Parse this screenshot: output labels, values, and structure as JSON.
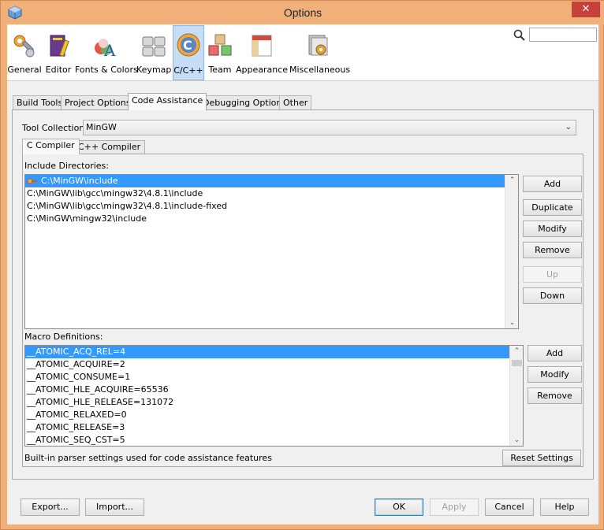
{
  "window": {
    "title": "Options",
    "close_glyph": "✕"
  },
  "categories": [
    {
      "label": "General",
      "icon": "wrench-gears-icon"
    },
    {
      "label": "Editor",
      "icon": "notebook-pencil-icon"
    },
    {
      "label": "Fonts & Colors",
      "icon": "font-colors-icon"
    },
    {
      "label": "Keymap",
      "icon": "keyboard-icon"
    },
    {
      "label": "C/C++",
      "icon": "cpp-icon",
      "selected": true
    },
    {
      "label": "Team",
      "icon": "team-cubes-icon"
    },
    {
      "label": "Appearance",
      "icon": "appearance-icon"
    },
    {
      "label": "Miscellaneous",
      "icon": "misc-icon"
    }
  ],
  "search": {
    "value": "",
    "placeholder": ""
  },
  "tabs": [
    "Build Tools",
    "Project Options",
    "Code Assistance",
    "Debugging Options",
    "Other"
  ],
  "active_tab": "Code Assistance",
  "tool_collection": {
    "label": "Tool Collection:",
    "value": "MinGW"
  },
  "subtabs": [
    "C Compiler",
    "C++ Compiler"
  ],
  "include": {
    "label": "Include Directories:",
    "items": [
      "C:\\MinGW\\include",
      "C:\\MinGW\\lib\\gcc\\mingw32\\4.8.1\\include",
      "C:\\MinGW\\lib\\gcc\\mingw32\\4.8.1\\include-fixed",
      "C:\\MinGW\\mingw32\\include"
    ],
    "buttons": {
      "add": "Add",
      "duplicate": "Duplicate",
      "modify": "Modify",
      "remove": "Remove",
      "up": "Up",
      "down": "Down"
    }
  },
  "macros": {
    "label": "Macro Definitions:",
    "items": [
      "__ATOMIC_ACQ_REL=4",
      "__ATOMIC_ACQUIRE=2",
      "__ATOMIC_CONSUME=1",
      "__ATOMIC_HLE_ACQUIRE=65536",
      "__ATOMIC_HLE_RELEASE=131072",
      "__ATOMIC_RELAXED=0",
      "__ATOMIC_RELEASE=3",
      "__ATOMIC_SEQ_CST=5"
    ],
    "buttons": {
      "add": "Add",
      "modify": "Modify",
      "remove": "Remove"
    }
  },
  "note": "Built-in parser settings used for code assistance features",
  "reset_button": "Reset Settings",
  "footer": {
    "export": "Export...",
    "import": "Import...",
    "ok": "OK",
    "apply": "Apply",
    "cancel": "Cancel",
    "help": "Help"
  },
  "colors": {
    "selection": "#3399ff",
    "title_bar": "#f1b079",
    "close": "#c7403a"
  }
}
